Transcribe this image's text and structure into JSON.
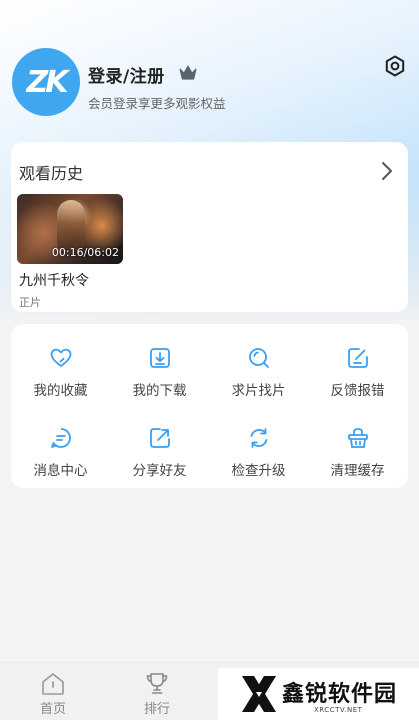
{
  "profile": {
    "avatar_text": "ZK",
    "login_title": "登录/注册",
    "subtitle": "会员登录享更多观影权益"
  },
  "history": {
    "title": "观看历史",
    "items": [
      {
        "title": "九州千秋令",
        "type": "正片",
        "progress": "00:16/06:02"
      }
    ]
  },
  "features": [
    {
      "label": "我的收藏",
      "icon": "heart-icon"
    },
    {
      "label": "我的下载",
      "icon": "download-icon"
    },
    {
      "label": "求片找片",
      "icon": "search-icon"
    },
    {
      "label": "反馈报错",
      "icon": "feedback-edit-icon"
    },
    {
      "label": "消息中心",
      "icon": "message-icon"
    },
    {
      "label": "分享好友",
      "icon": "share-icon"
    },
    {
      "label": "检查升级",
      "icon": "refresh-icon"
    },
    {
      "label": "清理缓存",
      "icon": "basket-icon"
    }
  ],
  "tabbar": {
    "tabs": [
      {
        "label": "首页",
        "icon": "home-icon"
      },
      {
        "label": "排行",
        "icon": "trophy-icon"
      }
    ]
  },
  "watermark": {
    "text": "鑫锐软件园",
    "sub": "XRCCTV.NET"
  },
  "colors": {
    "accent": "#3a9ff0",
    "header_gradient_end": "#a9d6f9",
    "background": "#f3f3f3"
  }
}
